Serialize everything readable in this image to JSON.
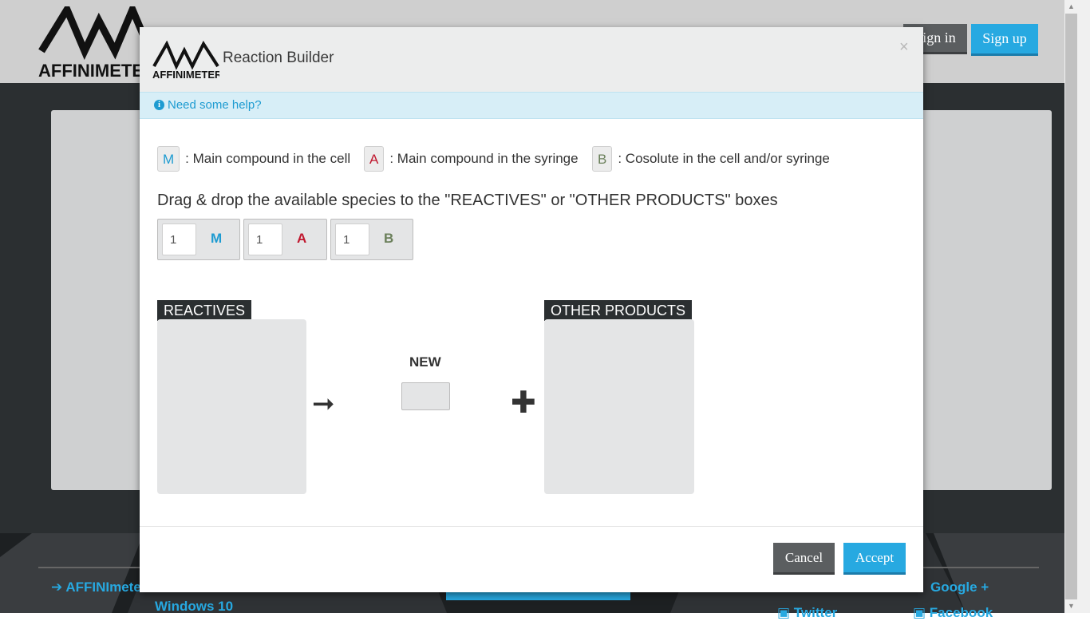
{
  "background": {
    "logo_text": "AFFINIMETER",
    "signin_label": "Sign in",
    "signup_label": "Sign up",
    "footer_links": [
      "AFFINImeter",
      "Windows 10",
      "Google +",
      "Twitter",
      "Facebook"
    ]
  },
  "modal": {
    "logo_text": "AFFINIMETER",
    "title": "Reaction Builder",
    "close_symbol": "×",
    "help_text": "Need some help?",
    "legend": [
      {
        "symbol": "M",
        "text": ": Main compound in the cell",
        "color": "#1d9bd1"
      },
      {
        "symbol": "A",
        "text": ": Main compound in the syringe",
        "color": "#c0172e"
      },
      {
        "symbol": "B",
        "text": ": Cosolute in the cell and/or syringe",
        "color": "#6a7f5a"
      }
    ],
    "instruction": "Drag & drop the available species to the \"REACTIVES\" or \"OTHER PRODUCTS\" boxes",
    "species": [
      {
        "count": "1",
        "symbol": "M",
        "color": "#1d9bd1"
      },
      {
        "count": "1",
        "symbol": "A",
        "color": "#c0172e"
      },
      {
        "count": "1",
        "symbol": "B",
        "color": "#6a7f5a"
      }
    ],
    "reactives_label": "REACTIVES",
    "arrow_symbol": "➞",
    "new_label": "NEW",
    "plus_symbol": "✚",
    "other_products_label": "OTHER PRODUCTS",
    "cancel_label": "Cancel",
    "accept_label": "Accept"
  },
  "colors": {
    "accent": "#27a9e1",
    "dark": "#2b2f31",
    "help_bg": "#d7eef7"
  }
}
